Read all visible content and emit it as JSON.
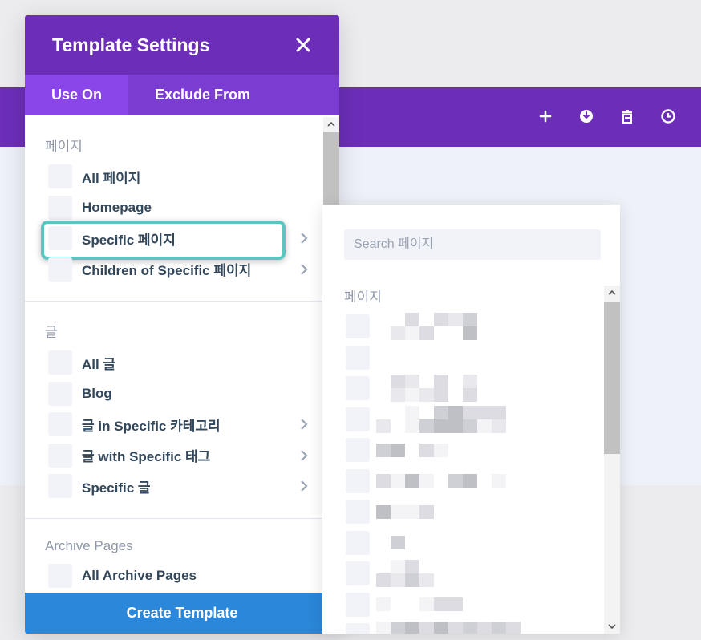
{
  "modal": {
    "title": "Template Settings",
    "tabs": [
      {
        "label": "Use On",
        "active": true
      },
      {
        "label": "Exclude From",
        "active": false
      }
    ],
    "sections": [
      {
        "title": "페이지",
        "options": [
          {
            "label": "All 페이지",
            "has_submenu": false
          },
          {
            "label": "Homepage",
            "has_submenu": false
          },
          {
            "label": "Specific 페이지",
            "has_submenu": true,
            "highlighted": true
          },
          {
            "label": "Children of Specific 페이지",
            "has_submenu": true
          }
        ]
      },
      {
        "title": "글",
        "options": [
          {
            "label": "All 글",
            "has_submenu": false
          },
          {
            "label": "Blog",
            "has_submenu": false
          },
          {
            "label": "글 in Specific 카테고리",
            "has_submenu": true
          },
          {
            "label": "글 with Specific 태그",
            "has_submenu": true
          },
          {
            "label": "Specific 글",
            "has_submenu": true
          }
        ]
      },
      {
        "title": "Archive Pages",
        "options": [
          {
            "label": "All Archive Pages",
            "has_submenu": false
          }
        ]
      }
    ],
    "create_button": "Create Template"
  },
  "flyout": {
    "search_placeholder": "Search 페이지",
    "section_title": "페이지",
    "items_count": 11
  },
  "toolbar": {
    "icons": [
      "plus-icon",
      "power-icon",
      "trash-icon",
      "history-icon"
    ]
  },
  "colors": {
    "purple": "#6c2eb9",
    "tab_bar": "#7b3cd1",
    "active_tab": "#8a46e8",
    "highlight": "#5fc4c0",
    "button_blue": "#2b87da"
  }
}
